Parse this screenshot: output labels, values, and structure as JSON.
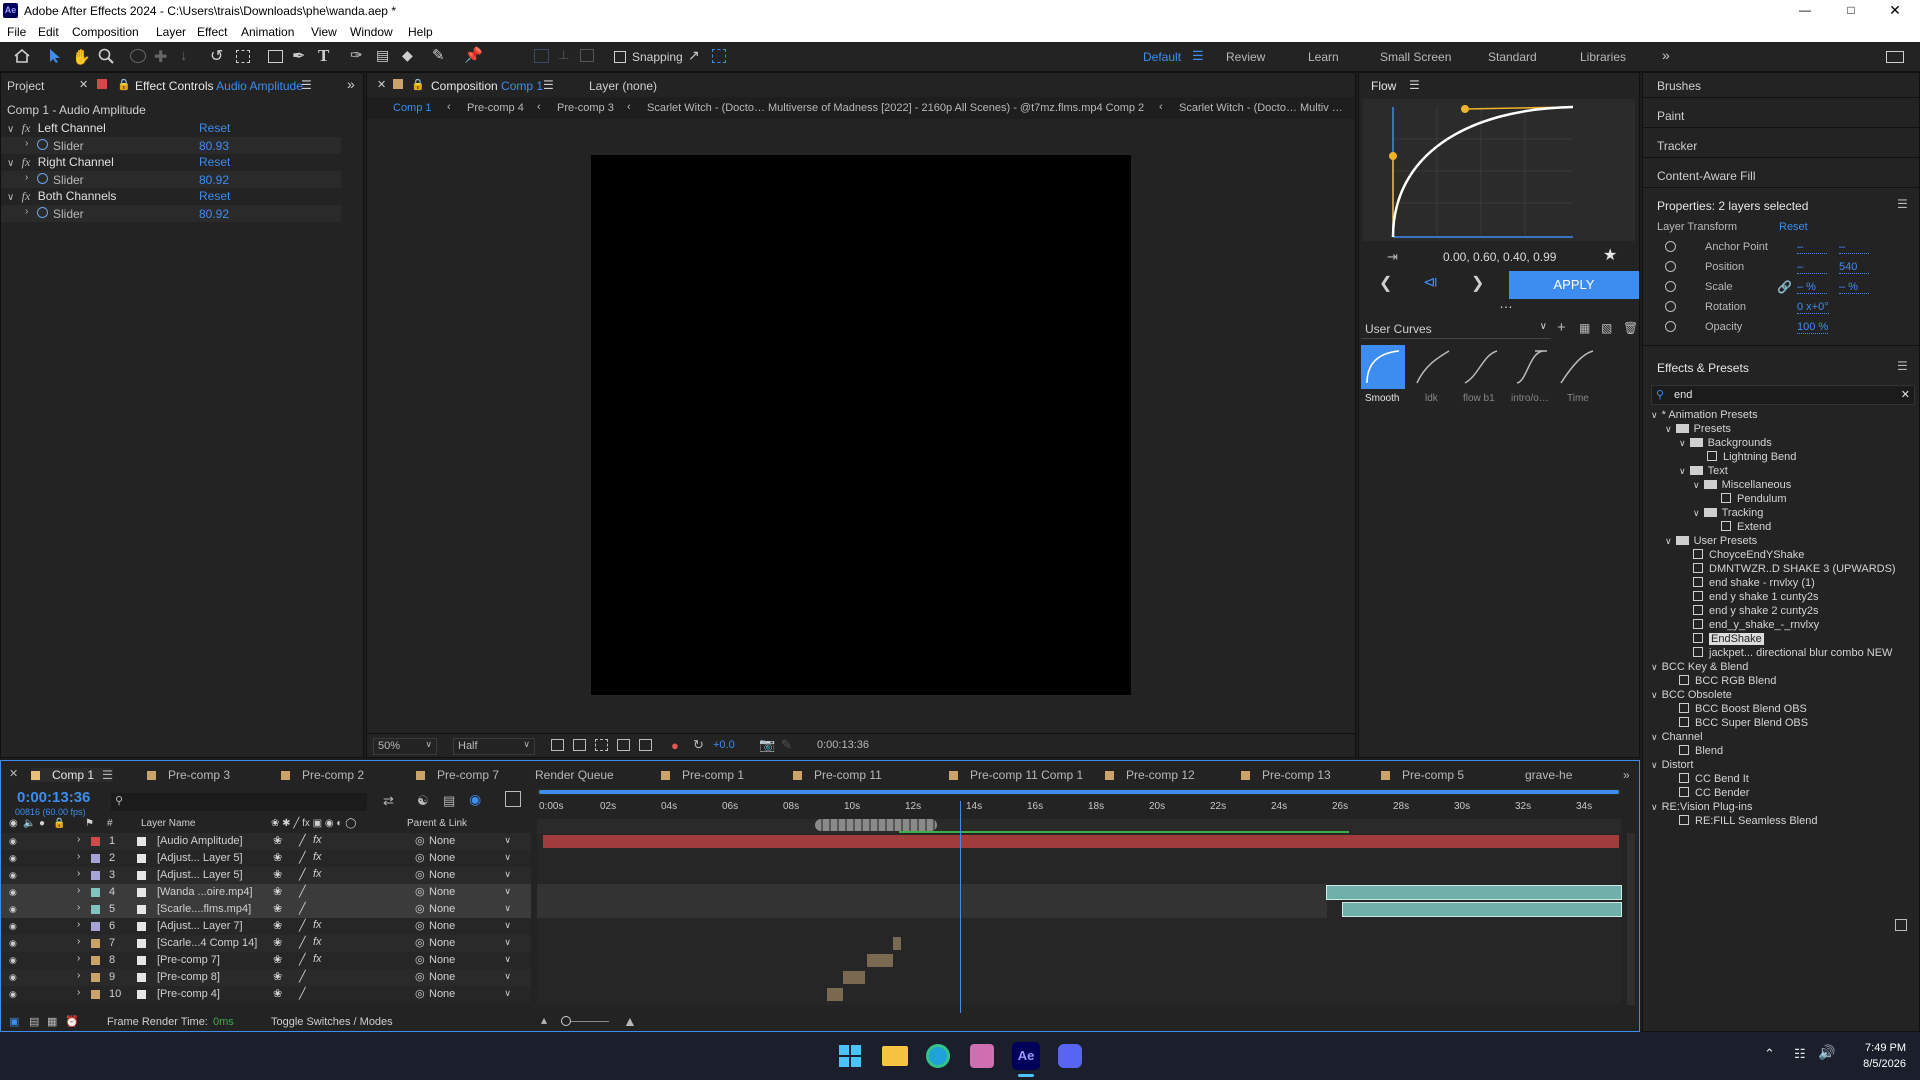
{
  "window": {
    "title": "Adobe After Effects 2024 - C:\\Users\\trais\\Downloads\\phe\\wanda.aep *",
    "app_badge": "Ae"
  },
  "menu": [
    "File",
    "Edit",
    "Composition",
    "Layer",
    "Effect",
    "Animation",
    "View",
    "Window",
    "Help"
  ],
  "toolbar": {
    "snapping_label": "Snapping",
    "workspaces": [
      "Default",
      "Review",
      "Learn",
      "Small Screen",
      "Standard",
      "Libraries"
    ],
    "active_workspace": "Default"
  },
  "left_panel": {
    "tab_project": "Project",
    "tab_effect_controls": "Effect Controls",
    "effect_target": "Audio Amplitude",
    "header_line": "Comp 1 - Audio Amplitude",
    "effects": [
      {
        "name": "Left Channel",
        "reset": "Reset",
        "slider_label": "Slider",
        "slider_value": "80.93"
      },
      {
        "name": "Right Channel",
        "reset": "Reset",
        "slider_label": "Slider",
        "slider_value": "80.92"
      },
      {
        "name": "Both Channels",
        "reset": "Reset",
        "slider_label": "Slider",
        "slider_value": "80.92"
      }
    ]
  },
  "comp_panel": {
    "tab_label": "Composition",
    "tab_comp": "Comp 1",
    "layer_tab": "Layer (none)",
    "breadcrumbs": [
      "Comp 1",
      "Pre-comp 4",
      "Pre-comp 3",
      "Scarlet Witch - (Docto…  Multiverse of Madness [2022] - 2160p All Scenes) - @t7mz.flms.mp4 Comp 2",
      "Scarlet Witch - (Docto…  Multiv …"
    ],
    "zoom": "50%",
    "resolution": "Half",
    "exposure": "+0.0",
    "timecode": "0:00:13:36"
  },
  "flow_panel": {
    "title": "Flow",
    "values_text": "0.00, 0.60, 0.40, 0.99",
    "apply_label": "APPLY",
    "curves_dropdown": "User Curves",
    "presets": [
      {
        "name": "Smooth",
        "active": true
      },
      {
        "name": "ldk",
        "active": false
      },
      {
        "name": "flow b1",
        "active": false
      },
      {
        "name": "intro/o…",
        "active": false
      },
      {
        "name": "Time",
        "active": false
      }
    ],
    "accent": "#3d8df0",
    "curve_color": "#f0b429"
  },
  "right_panel": {
    "collapsed_panels": [
      "Brushes",
      "Paint",
      "Tracker",
      "Content-Aware Fill"
    ],
    "properties_title": "Properties: 2 layers selected",
    "layer_transform_label": "Layer Transform",
    "reset_label": "Reset",
    "props": [
      {
        "name": "Anchor Point",
        "v1": "–",
        "v2": "–"
      },
      {
        "name": "Position",
        "v1": "–",
        "v2": "540"
      },
      {
        "name": "Scale",
        "v1": "– %",
        "v2": "– %"
      },
      {
        "name": "Rotation",
        "v1": "0 x+0°",
        "v2": ""
      },
      {
        "name": "Opacity",
        "v1": "100 %",
        "v2": ""
      }
    ],
    "effects_presets_title": "Effects & Presets",
    "search_value": "end"
  },
  "effects_tree": [
    {
      "label": "* Animation Presets",
      "indent": 0,
      "kind": "category"
    },
    {
      "label": "Presets",
      "indent": 1,
      "kind": "folder"
    },
    {
      "label": "Backgrounds",
      "indent": 2,
      "kind": "folder"
    },
    {
      "label": "Lightning Bend",
      "indent": 3,
      "kind": "preset"
    },
    {
      "label": "Text",
      "indent": 2,
      "kind": "folder"
    },
    {
      "label": "Miscellaneous",
      "indent": 3,
      "kind": "folder"
    },
    {
      "label": "Pendulum",
      "indent": 4,
      "kind": "preset"
    },
    {
      "label": "Tracking",
      "indent": 3,
      "kind": "folder"
    },
    {
      "label": "Extend",
      "indent": 4,
      "kind": "preset"
    },
    {
      "label": "User Presets",
      "indent": 1,
      "kind": "folder"
    },
    {
      "label": "ChoyceEndYShake",
      "indent": 2,
      "kind": "preset"
    },
    {
      "label": "DMNTWZR..D SHAKE 3 (UPWARDS)",
      "indent": 2,
      "kind": "preset"
    },
    {
      "label": "end shake - rnvlxy (1)",
      "indent": 2,
      "kind": "preset"
    },
    {
      "label": "end y shake 1 cunty2s",
      "indent": 2,
      "kind": "preset"
    },
    {
      "label": "end y shake 2 cunty2s",
      "indent": 2,
      "kind": "preset"
    },
    {
      "label": "end_y_shake_-_rnvlxy",
      "indent": 2,
      "kind": "preset"
    },
    {
      "label": "EndShake",
      "indent": 2,
      "kind": "preset",
      "selected": true
    },
    {
      "label": "jackpet... directional blur combo NEW",
      "indent": 2,
      "kind": "preset"
    },
    {
      "label": "BCC Key & Blend",
      "indent": 0,
      "kind": "category"
    },
    {
      "label": "BCC RGB Blend",
      "indent": 1,
      "kind": "preset"
    },
    {
      "label": "BCC Obsolete",
      "indent": 0,
      "kind": "category"
    },
    {
      "label": "BCC Boost Blend OBS",
      "indent": 1,
      "kind": "preset"
    },
    {
      "label": "BCC Super Blend OBS",
      "indent": 1,
      "kind": "preset"
    },
    {
      "label": "Channel",
      "indent": 0,
      "kind": "category"
    },
    {
      "label": "Blend",
      "indent": 1,
      "kind": "preset"
    },
    {
      "label": "Distort",
      "indent": 0,
      "kind": "category"
    },
    {
      "label": "CC Bend It",
      "indent": 1,
      "kind": "preset"
    },
    {
      "label": "CC Bender",
      "indent": 1,
      "kind": "preset"
    },
    {
      "label": "RE:Vision Plug-ins",
      "indent": 0,
      "kind": "category"
    },
    {
      "label": "RE:FILL Seamless Blend",
      "indent": 1,
      "kind": "preset"
    }
  ],
  "timeline": {
    "tabs": [
      {
        "label": "Comp 1",
        "color": "#e8c07a",
        "active": true
      },
      {
        "label": "Pre-comp 3",
        "color": "#c9a36a"
      },
      {
        "label": "Pre-comp 2",
        "color": "#c9a36a"
      },
      {
        "label": "Pre-comp 7",
        "color": "#c9a36a"
      },
      {
        "label": "Render Queue",
        "color": ""
      },
      {
        "label": "Pre-comp 1",
        "color": "#c9a36a"
      },
      {
        "label": "Pre-comp 11",
        "color": "#c9a36a"
      },
      {
        "label": "Pre-comp 11 Comp 1",
        "color": "#c9a36a"
      },
      {
        "label": "Pre-comp 12",
        "color": "#c9a36a"
      },
      {
        "label": "Pre-comp 13",
        "color": "#c9a36a"
      },
      {
        "label": "Pre-comp 5",
        "color": "#c9a36a"
      },
      {
        "label": "grave-he",
        "color": ""
      }
    ],
    "current_time": "0:00:13:36",
    "frame_info": "00816 (60.00 fps)",
    "col_layer_name": "Layer Name",
    "col_parent": "Parent & Link",
    "ruler": [
      "0:00s",
      "02s",
      "04s",
      "06s",
      "08s",
      "10s",
      "12s",
      "14s",
      "16s",
      "18s",
      "20s",
      "22s",
      "24s",
      "26s",
      "28s",
      "30s",
      "32s",
      "34s"
    ],
    "playhead_fraction": 0.3894,
    "layers": [
      {
        "num": "1",
        "name": "[Audio Amplitude]",
        "label": "#d14a4a",
        "parent": "None",
        "fx": true
      },
      {
        "num": "2",
        "name": "[Adjust... Layer 5]",
        "label": "#a7a3d6",
        "parent": "None",
        "fx": true
      },
      {
        "num": "3",
        "name": "[Adjust... Layer 5]",
        "label": "#a7a3d6",
        "parent": "None",
        "fx": true
      },
      {
        "num": "4",
        "name": "[Wanda ...oire.mp4]",
        "label": "#7fc4bd",
        "parent": "None",
        "fx": false,
        "selected": true
      },
      {
        "num": "5",
        "name": "[Scarle....flms.mp4]",
        "label": "#7fc4bd",
        "parent": "None",
        "fx": false,
        "selected": true
      },
      {
        "num": "6",
        "name": "[Adjust... Layer 7]",
        "label": "#a7a3d6",
        "parent": "None",
        "fx": true
      },
      {
        "num": "7",
        "name": "[Scarle...4 Comp 14]",
        "label": "#c9a36a",
        "parent": "None",
        "fx": true
      },
      {
        "num": "8",
        "name": "[Pre-comp 7]",
        "label": "#c9a36a",
        "parent": "None",
        "fx": true
      },
      {
        "num": "9",
        "name": "[Pre-comp 8]",
        "label": "#c9a36a",
        "parent": "None",
        "fx": false
      },
      {
        "num": "10",
        "name": "[Pre-comp 4]",
        "label": "#c9a36a",
        "parent": "None",
        "fx": false
      }
    ],
    "footer_frame_render_label": "Frame Render Time:",
    "footer_frame_render_value": "0ms",
    "footer_toggle": "Toggle Switches / Modes"
  },
  "taskbar": {
    "time": "7:49 PM",
    "date": "8/5/2026",
    "apps": [
      "windows-start",
      "file-explorer",
      "edge",
      "app-pink",
      "after-effects",
      "discord"
    ]
  }
}
